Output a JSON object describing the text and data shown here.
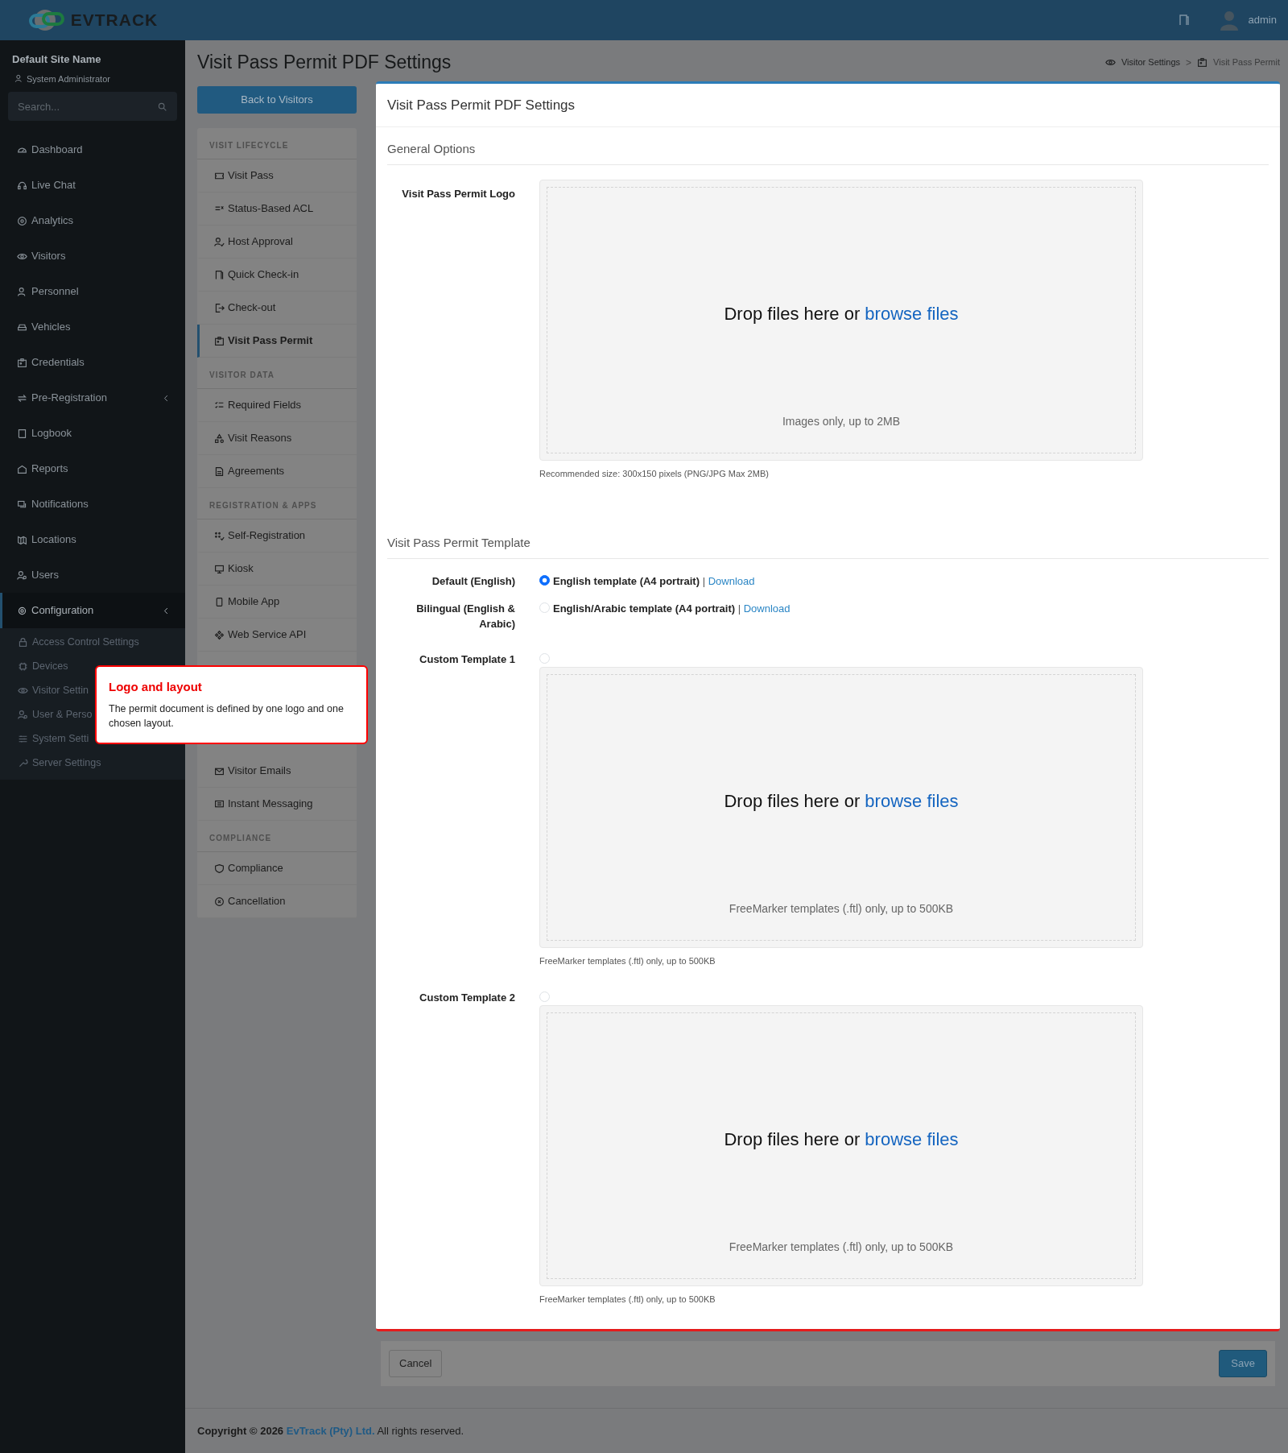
{
  "header": {
    "brand": "EVTRACK",
    "user": "admin"
  },
  "sidebar": {
    "site_name": "Default Site Name",
    "role": "System Administrator",
    "search": {
      "placeholder": "Search..."
    },
    "items": [
      {
        "label": "Dashboard",
        "selected": false,
        "expandable": false
      },
      {
        "label": "Live Chat",
        "selected": false,
        "expandable": false
      },
      {
        "label": "Analytics",
        "selected": false,
        "expandable": false
      },
      {
        "label": "Visitors",
        "selected": false,
        "expandable": false
      },
      {
        "label": "Personnel",
        "selected": false,
        "expandable": false
      },
      {
        "label": "Vehicles",
        "selected": false,
        "expandable": false
      },
      {
        "label": "Credentials",
        "selected": false,
        "expandable": false
      },
      {
        "label": "Pre-Registration",
        "selected": false,
        "expandable": true
      },
      {
        "label": "Logbook",
        "selected": false,
        "expandable": false
      },
      {
        "label": "Reports",
        "selected": false,
        "expandable": false
      },
      {
        "label": "Notifications",
        "selected": false,
        "expandable": false
      },
      {
        "label": "Locations",
        "selected": false,
        "expandable": false
      },
      {
        "label": "Users",
        "selected": false,
        "expandable": false
      },
      {
        "label": "Configuration",
        "selected": true,
        "expandable": true,
        "children": [
          {
            "label": "Access Control Settings"
          },
          {
            "label": "Devices"
          },
          {
            "label": "Visitor Settin"
          },
          {
            "label": "User & Perso"
          },
          {
            "label": "System Setti"
          },
          {
            "label": "Server Settings"
          }
        ]
      }
    ]
  },
  "page_title": "Visit Pass Permit PDF Settings",
  "breadcrumb": [
    "Visitor Settings",
    "Visit Pass Permit"
  ],
  "breadcrumb_separator": ">",
  "back_button": "Back to Visitors",
  "settings_nav": [
    {
      "heading": "VISIT LIFECYCLE",
      "items": [
        {
          "label": "Visit Pass",
          "selected": false
        },
        {
          "label": "Status-Based ACL",
          "selected": false
        },
        {
          "label": "Host Approval",
          "selected": false
        },
        {
          "label": "Quick Check-in",
          "selected": false
        },
        {
          "label": "Check-out",
          "selected": false
        },
        {
          "label": "Visit Pass Permit",
          "selected": true
        }
      ]
    },
    {
      "heading": "VISITOR DATA",
      "items": [
        {
          "label": "Required Fields",
          "selected": false
        },
        {
          "label": "Visit Reasons",
          "selected": false
        },
        {
          "label": "Agreements",
          "selected": false
        }
      ]
    },
    {
      "heading": "REGISTRATION & APPS",
      "items": [
        {
          "label": "Self-Registration",
          "selected": false
        },
        {
          "label": "Kiosk",
          "selected": false
        },
        {
          "label": "Mobile App",
          "selected": false
        },
        {
          "label": "Web Service API",
          "selected": false
        }
      ]
    },
    {
      "items": [
        {
          "label": "Visitor Emails",
          "selected": false
        },
        {
          "label": "Instant Messaging",
          "selected": false
        }
      ]
    },
    {
      "heading": "COMPLIANCE",
      "items": [
        {
          "label": "Compliance",
          "selected": false
        },
        {
          "label": "Cancellation",
          "selected": false
        }
      ]
    }
  ],
  "card": {
    "title": "Visit Pass Permit PDF Settings",
    "general": {
      "heading": "General Options",
      "logo": {
        "label": "Visit Pass Permit Logo",
        "drop_text": "Drop files here or",
        "browse": "browse files",
        "hint": "Images only, up to 2MB",
        "note": "Recommended size: 300x150 pixels (PNG/JPG Max 2MB)"
      }
    },
    "template": {
      "heading": "Visit Pass Permit Template",
      "options": [
        {
          "kind": "builtin",
          "label": "Default (English)",
          "selected": true,
          "text": "English template (A4 portrait)",
          "separator": "|",
          "link": "Download"
        },
        {
          "kind": "builtin",
          "label": "Bilingual (English & Arabic)",
          "selected": false,
          "text": "English/Arabic template (A4 portrait)",
          "separator": "|",
          "link": "Download"
        },
        {
          "kind": "custom",
          "label": "Custom Template 1",
          "selected": false,
          "drop_text": "Drop files here or",
          "browse": "browse files",
          "hint": "FreeMarker templates (.ftl) only, up to 500KB",
          "note": "FreeMarker templates (.ftl) only, up to 500KB"
        },
        {
          "kind": "custom",
          "label": "Custom Template 2",
          "selected": false,
          "drop_text": "Drop files here or",
          "browse": "browse files",
          "hint": "FreeMarker templates (.ftl) only, up to 500KB",
          "note": "FreeMarker templates (.ftl) only, up to 500KB"
        }
      ]
    }
  },
  "actions": {
    "cancel": "Cancel",
    "save": "Save"
  },
  "footer": {
    "prefix": "Copyright © 2026",
    "company": "EvTrack (Pty) Ltd.",
    "suffix": "All rights reserved."
  },
  "callout": {
    "title": "Logo and layout",
    "body": "The permit document is defined by one logo and one chosen layout."
  }
}
